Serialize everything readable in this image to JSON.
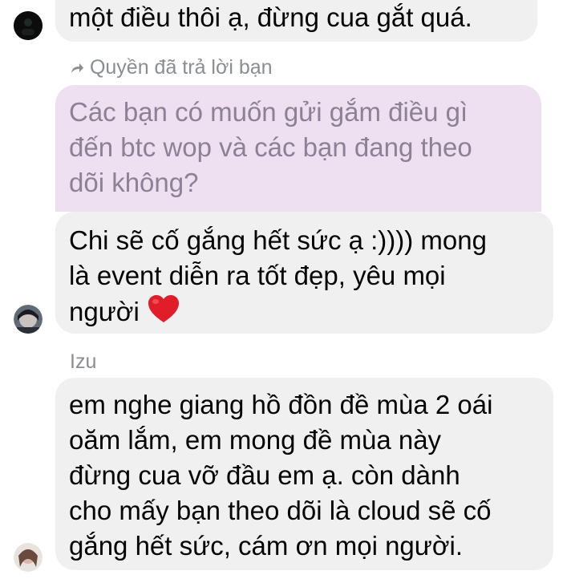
{
  "messages": [
    {
      "text": "một điều thôi ạ, đừng cua gắt quá."
    },
    {
      "reply_info": "Quyền đã trả lời bạn",
      "quoted_text": "Các bạn có muốn gửi gắm điều gì\nđến btc wop và các bạn đang theo\ndõi không?",
      "text": "Chi sẽ cố gắng hết sức ạ :)))) mong\nlà event diễn ra tốt đẹp, yêu mọi\nngười",
      "emoji": "red-heart"
    },
    {
      "sender": "Izu",
      "text": "em nghe giang hồ đồn đề mùa 2 oái\noăm lắm, em mong đề mùa này\nđừng cua vỡ đầu em ạ. còn dành\ncho mấy bạn theo dõi là cloud sẽ cố\ngắng hết sức, cám ơn mọi người."
    }
  ],
  "colors": {
    "bubble": "#f0f0f0",
    "quoted": "#efe0f1",
    "meta": "#8a8d91",
    "text": "#050505"
  }
}
